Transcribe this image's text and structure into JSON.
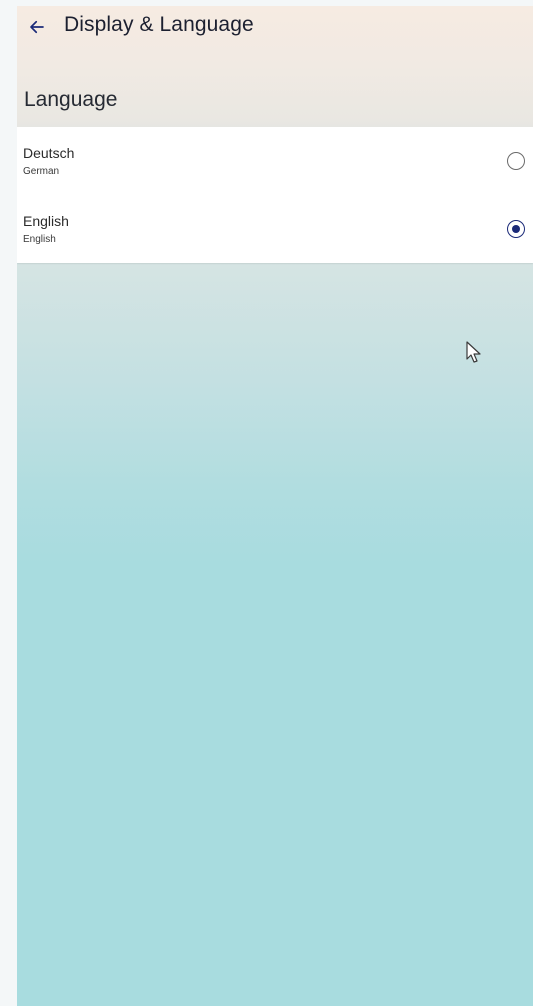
{
  "header": {
    "title": "Display & Language",
    "back_icon": "arrow-left-icon"
  },
  "section": {
    "title": "Language"
  },
  "languages": [
    {
      "name": "Deutsch",
      "subtitle": "German",
      "selected": false
    },
    {
      "name": "English",
      "subtitle": "English",
      "selected": true
    }
  ],
  "colors": {
    "accent": "#1b2a78",
    "background_top": "#f6ebe2",
    "background_bottom": "#a8dcdf"
  }
}
